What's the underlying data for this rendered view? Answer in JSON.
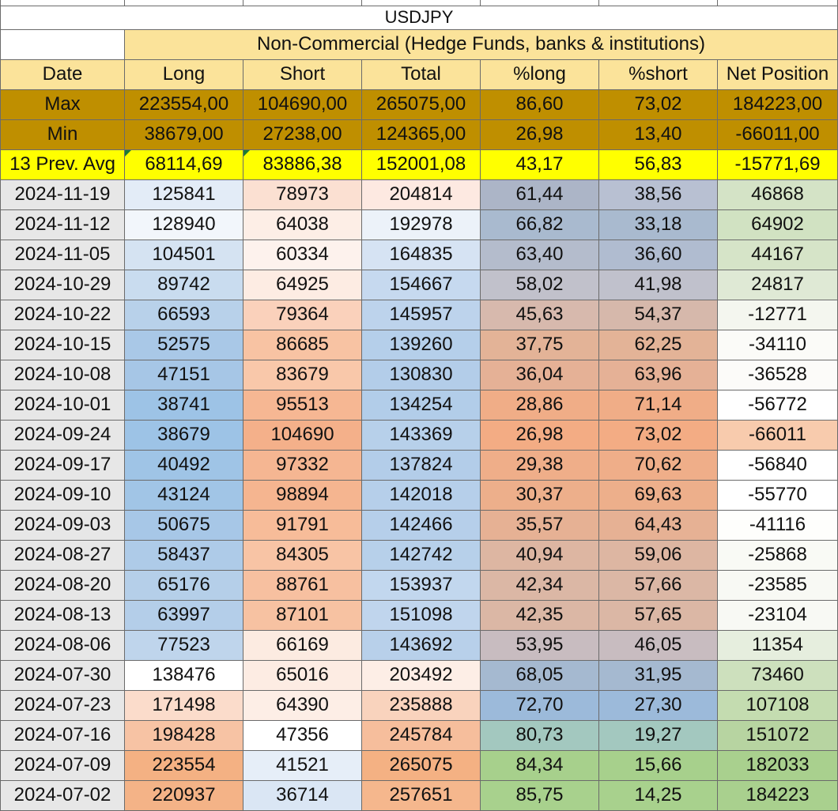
{
  "sheet": {
    "title": "USDJPY",
    "subtitle": "Non-Commercial (Hedge Funds, banks & institutions)",
    "headers": [
      "Date",
      "Long",
      "Short",
      "Total",
      "%long",
      "%short",
      "Net Position"
    ],
    "max_row": [
      "Max",
      "223554,00",
      "104690,00",
      "265075,00",
      "86,60",
      "73,02",
      "184223,00"
    ],
    "min_row": [
      "Min",
      "38679,00",
      "27238,00",
      "124365,00",
      "26,98",
      "13,40",
      "-66011,00"
    ],
    "avg_row": [
      "13 Prev. Avg",
      "68114,69",
      "83886,38",
      "152001,08",
      "43,17",
      "56,83",
      "-15771,69"
    ],
    "rows": [
      {
        "cells": [
          "2024-11-19",
          "125841",
          "78973",
          "204814",
          "61,44",
          "38,56",
          "46868"
        ],
        "colors": [
          "#e7e7e7",
          "#e3ecf7",
          "#fbe0d2",
          "#fde9e1",
          "#acb5c7",
          "#b8c0d2",
          "#d4e3c6"
        ]
      },
      {
        "cells": [
          "2024-11-12",
          "128940",
          "64038",
          "192978",
          "66,82",
          "33,18",
          "64902"
        ],
        "colors": [
          "#e7e7e7",
          "#f2f6fb",
          "#fdeee6",
          "#ecf2f9",
          "#a9bacf",
          "#a9bacf",
          "#d1e2c2"
        ]
      },
      {
        "cells": [
          "2024-11-05",
          "104501",
          "60334",
          "164835",
          "63,40",
          "36,60",
          "44167"
        ],
        "colors": [
          "#e7e7e7",
          "#d5e3f2",
          "#fdf2ed",
          "#d6e3f3",
          "#b4bccc",
          "#b0bcd0",
          "#d6e4c8"
        ]
      },
      {
        "cells": [
          "2024-10-29",
          "89742",
          "64925",
          "154667",
          "58,02",
          "41,98",
          "24817"
        ],
        "colors": [
          "#e7e7e7",
          "#c9dcef",
          "#fdece3",
          "#c6d9ef",
          "#c1c1cb",
          "#c0c1cc",
          "#dfe9d5"
        ]
      },
      {
        "cells": [
          "2024-10-22",
          "66593",
          "79364",
          "145957",
          "45,63",
          "54,37",
          "-12771"
        ],
        "colors": [
          "#e7e7e7",
          "#b8d1ea",
          "#fad1bb",
          "#bdd3ec",
          "#d7b9ad",
          "#d6b8ab",
          "#f4f6ef"
        ]
      },
      {
        "cells": [
          "2024-10-15",
          "52575",
          "86685",
          "139260",
          "37,75",
          "62,25",
          "-34110"
        ],
        "colors": [
          "#e7e7e7",
          "#a9c8e7",
          "#f8c3a3",
          "#b5cfea",
          "#e3b397",
          "#e3b397",
          "#fbfbf8"
        ]
      },
      {
        "cells": [
          "2024-10-08",
          "47151",
          "83679",
          "130830",
          "36,04",
          "63,96",
          "-36528"
        ],
        "colors": [
          "#e7e7e7",
          "#a6c6e6",
          "#f9c8aa",
          "#b3cde9",
          "#e5b196",
          "#e5b196",
          "#fcfbf9"
        ]
      },
      {
        "cells": [
          "2024-10-01",
          "38741",
          "95513",
          "134254",
          "28,86",
          "71,14",
          "-56772"
        ],
        "colors": [
          "#e7e7e7",
          "#9dc3e6",
          "#f6b793",
          "#b2cde9",
          "#f0ad87",
          "#f0ad87",
          "#ffffff"
        ]
      },
      {
        "cells": [
          "2024-09-24",
          "38679",
          "104690",
          "143369",
          "26,98",
          "73,02",
          "-66011"
        ],
        "colors": [
          "#e7e7e7",
          "#9dc3e6",
          "#f4b08a",
          "#b7d0ea",
          "#f3ac84",
          "#f3ac84",
          "#f8cbad"
        ]
      },
      {
        "cells": [
          "2024-09-17",
          "40492",
          "97332",
          "137824",
          "29,38",
          "70,62",
          "-56840"
        ],
        "colors": [
          "#e7e7e7",
          "#9fc4e6",
          "#f5b692",
          "#b3cde9",
          "#efae89",
          "#efae89",
          "#ffffff"
        ]
      },
      {
        "cells": [
          "2024-09-10",
          "43124",
          "98894",
          "142018",
          "30,37",
          "69,63",
          "-55770"
        ],
        "colors": [
          "#e7e7e7",
          "#a1c5e6",
          "#f5b590",
          "#b6cfea",
          "#edaf8b",
          "#edaf8b",
          "#ffffff"
        ]
      },
      {
        "cells": [
          "2024-09-03",
          "50675",
          "91791",
          "142466",
          "35,57",
          "64,43",
          "-41116"
        ],
        "colors": [
          "#e7e7e7",
          "#a7c7e7",
          "#f7bc99",
          "#b6cfea",
          "#e6b194",
          "#e6b194",
          "#fefefc"
        ]
      },
      {
        "cells": [
          "2024-08-27",
          "58437",
          "84305",
          "142742",
          "40,94",
          "59,06",
          "-25868"
        ],
        "colors": [
          "#e7e7e7",
          "#aecbe8",
          "#f8c4a5",
          "#b7d0ea",
          "#ddb6a2",
          "#ddb6a2",
          "#f9faf5"
        ]
      },
      {
        "cells": [
          "2024-08-20",
          "65176",
          "88761",
          "153937",
          "42,34",
          "57,66",
          "-23585"
        ],
        "colors": [
          "#e7e7e7",
          "#b5cfe9",
          "#f7c0a0",
          "#c2d7ee",
          "#dbb7a5",
          "#dbb7a5",
          "#f8f9f4"
        ]
      },
      {
        "cells": [
          "2024-08-13",
          "63997",
          "87101",
          "151098",
          "42,35",
          "57,65",
          "-23104"
        ],
        "colors": [
          "#e7e7e7",
          "#b4cee9",
          "#f7c2a2",
          "#c0d5ed",
          "#dbb7a5",
          "#dbb7a5",
          "#f8f9f4"
        ]
      },
      {
        "cells": [
          "2024-08-06",
          "77523",
          "66169",
          "143692",
          "53,95",
          "46,05",
          "11354"
        ],
        "colors": [
          "#e7e7e7",
          "#bfd5ec",
          "#fcebe1",
          "#b8d0ea",
          "#c8bcc0",
          "#c8bcc0",
          "#e6eede"
        ]
      },
      {
        "cells": [
          "2024-07-30",
          "138476",
          "65016",
          "203492",
          "68,05",
          "31,95",
          "73460"
        ],
        "colors": [
          "#e7e7e7",
          "#ffffff",
          "#fdece3",
          "#fdeee6",
          "#a5b9d0",
          "#a5b9d0",
          "#cde0bd"
        ]
      },
      {
        "cells": [
          "2024-07-23",
          "171498",
          "64390",
          "235888",
          "72,70",
          "27,30",
          "107108"
        ],
        "colors": [
          "#e7e7e7",
          "#fbdccb",
          "#fdeee6",
          "#f9d3bd",
          "#9cbada",
          "#9cbada",
          "#c4dcb0"
        ]
      },
      {
        "cells": [
          "2024-07-16",
          "198428",
          "47356",
          "245784",
          "80,73",
          "19,27",
          "151072"
        ],
        "colors": [
          "#e7e7e7",
          "#f7c3a4",
          "#ffffff",
          "#f6be9c",
          "#a3c8bf",
          "#a3c8bf",
          "#b7d4a1"
        ]
      },
      {
        "cells": [
          "2024-07-09",
          "223554",
          "41521",
          "265075",
          "84,34",
          "15,66",
          "182033"
        ],
        "colors": [
          "#e7e7e7",
          "#f4b183",
          "#e6eef8",
          "#f4b183",
          "#a7d08c",
          "#a7d08c",
          "#a9d08e"
        ]
      },
      {
        "cells": [
          "2024-07-02",
          "220937",
          "36714",
          "257651",
          "85,75",
          "14,25",
          "184223"
        ],
        "colors": [
          "#e7e7e7",
          "#f4b387",
          "#dae6f4",
          "#f5b78d",
          "#a8d18d",
          "#a8d18d",
          "#a9d08e"
        ]
      }
    ]
  }
}
